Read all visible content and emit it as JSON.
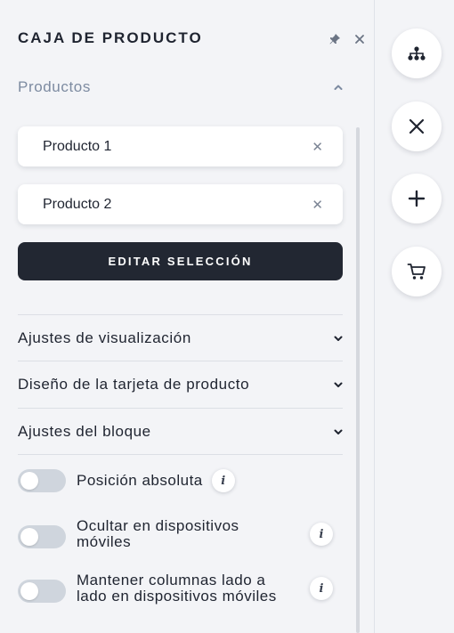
{
  "panel": {
    "title": "CAJA DE PRODUCTO",
    "header_icons": [
      "pin-icon",
      "close-icon"
    ]
  },
  "productos": {
    "label": "Productos",
    "expanded": true,
    "items": [
      {
        "label": "Producto 1"
      },
      {
        "label": "Producto 2"
      }
    ],
    "edit_button": "EDITAR SELECCIÓN"
  },
  "sections": [
    {
      "label": "Ajustes de visualización"
    },
    {
      "label": "Diseño de la tarjeta de producto"
    },
    {
      "label": "Ajustes del bloque"
    }
  ],
  "toggles": [
    {
      "label": "Posición absoluta",
      "checked": false
    },
    {
      "label_line1": "Ocultar en dispositivos",
      "label_line2": "móviles",
      "checked": false
    },
    {
      "label_line1": "Mantener columnas lado a",
      "label_line2": "lado en dispositivos móviles",
      "checked": false
    }
  ],
  "info_glyph": "i",
  "close_glyph": "✕",
  "rail": [
    "sitemap-icon",
    "close-icon",
    "plus-icon",
    "cart-icon"
  ]
}
